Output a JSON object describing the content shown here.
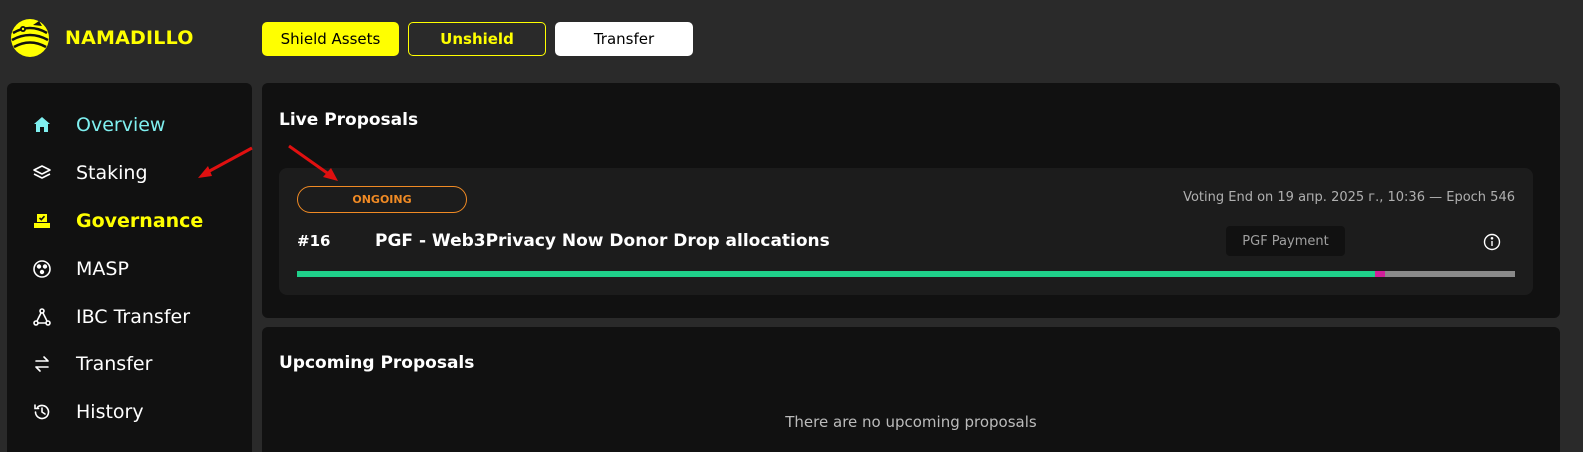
{
  "app": {
    "name": "NAMADILLO",
    "accent": "#ffff00"
  },
  "toolbar": {
    "shield_label": "Shield Assets",
    "unshield_label": "Unshield",
    "transfer_label": "Transfer"
  },
  "sidebar": {
    "items": [
      {
        "label": "Overview",
        "icon": "home-icon",
        "active": false
      },
      {
        "label": "Staking",
        "icon": "layers-icon",
        "active": false
      },
      {
        "label": "Governance",
        "icon": "ballot-icon",
        "active": true
      },
      {
        "label": "MASP",
        "icon": "masp-icon",
        "active": false
      },
      {
        "label": "IBC Transfer",
        "icon": "ibc-icon",
        "active": false
      },
      {
        "label": "Transfer",
        "icon": "arrows-icon",
        "active": false
      },
      {
        "label": "History",
        "icon": "history-icon",
        "active": false
      }
    ]
  },
  "live": {
    "title": "Live Proposals",
    "proposals": [
      {
        "status": "ONGOING",
        "voting_end": "Voting End on 19 апр. 2025 г., 10:36 — Epoch 546",
        "id": "#16",
        "title": "PGF - Web3Privacy Now Donor Drop allocations",
        "type": "PGF Payment",
        "votes": {
          "yes": 0.885,
          "no": 0.008,
          "abstain": 0.107
        }
      }
    ]
  },
  "upcoming": {
    "title": "Upcoming Proposals",
    "empty_message": "There are no upcoming proposals"
  },
  "colors": {
    "ongoing": "#f08a24",
    "yes": "#1fd08a",
    "no": "#d01f9a",
    "abstain": "#8a8a8a",
    "overview": "#7ff0f0"
  }
}
